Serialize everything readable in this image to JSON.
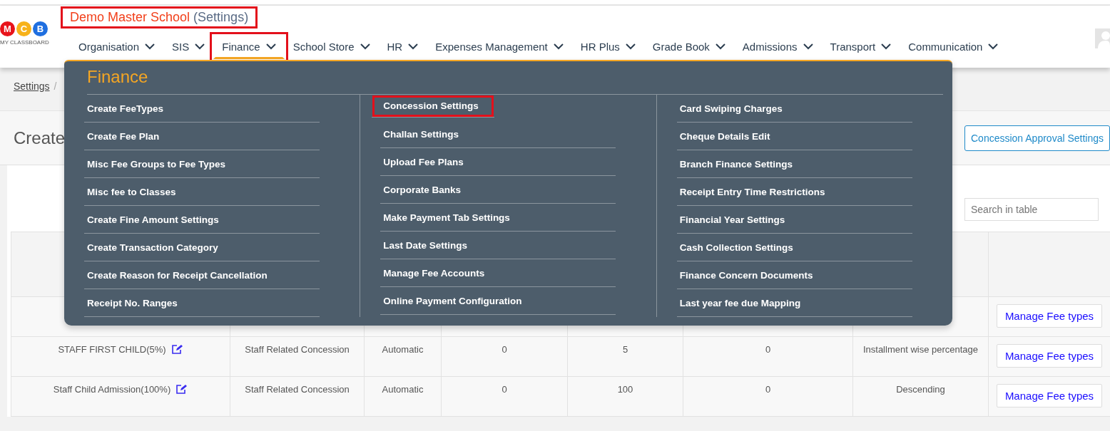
{
  "header": {
    "logo": {
      "letters": [
        {
          "char": "M",
          "color": "#e8141b"
        },
        {
          "char": "C",
          "color": "#f7b21a"
        },
        {
          "char": "B",
          "color": "#1f6fe0"
        }
      ],
      "caption": "MY CLASSBOARD"
    },
    "school_name": "Demo Master School",
    "context": "(Settings)",
    "title_highlighted": true,
    "nav": [
      {
        "label": "Organisation",
        "selected": false,
        "highlighted": false
      },
      {
        "label": "SIS",
        "selected": false,
        "highlighted": false
      },
      {
        "label": "Finance",
        "selected": true,
        "highlighted": true
      },
      {
        "label": "School Store",
        "selected": false,
        "highlighted": false
      },
      {
        "label": "HR",
        "selected": false,
        "highlighted": false
      },
      {
        "label": "Expenses Management",
        "selected": false,
        "highlighted": false
      },
      {
        "label": "HR Plus",
        "selected": false,
        "highlighted": false
      },
      {
        "label": "Grade Book",
        "selected": false,
        "highlighted": false
      },
      {
        "label": "Admissions",
        "selected": false,
        "highlighted": false
      },
      {
        "label": "Transport",
        "selected": false,
        "highlighted": false
      },
      {
        "label": "Communication",
        "selected": false,
        "highlighted": false
      }
    ]
  },
  "breadcrumb": {
    "link": "Settings",
    "separator": "/"
  },
  "page": {
    "heading": "Create",
    "button": "Concession Approval Settings",
    "search": {
      "placeholder": "Search in table"
    }
  },
  "table": {
    "rows": [
      {
        "action": "Manage Fee types"
      },
      {
        "cells": [
          "STAFF FIRST CHILD(5%)",
          "Staff Related Concession",
          "Automatic",
          "0",
          "5",
          "0",
          "Installment wise percentage"
        ],
        "action": "Manage Fee types"
      },
      {
        "cells": [
          "Staff Child Admission(100%)",
          "Staff Related Concession",
          "Automatic",
          "0",
          "100",
          "0",
          "Descending"
        ],
        "action": "Manage Fee types"
      }
    ]
  },
  "menu": {
    "title": "Finance",
    "columns": [
      [
        {
          "label": "Create FeeTypes",
          "highlighted": false
        },
        {
          "label": "Create Fee Plan",
          "highlighted": false
        },
        {
          "label": "Misc Fee Groups to Fee Types",
          "highlighted": false
        },
        {
          "label": "Misc fee to Classes",
          "highlighted": false
        },
        {
          "label": "Create Fine Amount Settings",
          "highlighted": false
        },
        {
          "label": "Create Transaction Category",
          "highlighted": false
        },
        {
          "label": "Create Reason for Receipt Cancellation",
          "highlighted": false
        },
        {
          "label": "Receipt No. Ranges",
          "highlighted": false
        }
      ],
      [
        {
          "label": "Concession Settings",
          "highlighted": true
        },
        {
          "label": "Challan Settings",
          "highlighted": false
        },
        {
          "label": "Upload Fee Plans",
          "highlighted": false
        },
        {
          "label": "Corporate Banks",
          "highlighted": false
        },
        {
          "label": "Make Payment Tab Settings",
          "highlighted": false
        },
        {
          "label": "Last Date Settings",
          "highlighted": false
        },
        {
          "label": "Manage Fee Accounts",
          "highlighted": false
        },
        {
          "label": "Online Payment Configuration",
          "highlighted": false
        }
      ],
      [
        {
          "label": "Card Swiping Charges",
          "highlighted": false
        },
        {
          "label": "Cheque Details Edit",
          "highlighted": false
        },
        {
          "label": "Branch Finance Settings",
          "highlighted": false
        },
        {
          "label": "Receipt Entry Time Restrictions",
          "highlighted": false
        },
        {
          "label": "Financial Year Settings",
          "highlighted": false
        },
        {
          "label": "Cash Collection Settings",
          "highlighted": false
        },
        {
          "label": "Finance Concern Documents",
          "highlighted": false
        },
        {
          "label": "Last year fee due Mapping",
          "highlighted": false
        }
      ]
    ]
  }
}
